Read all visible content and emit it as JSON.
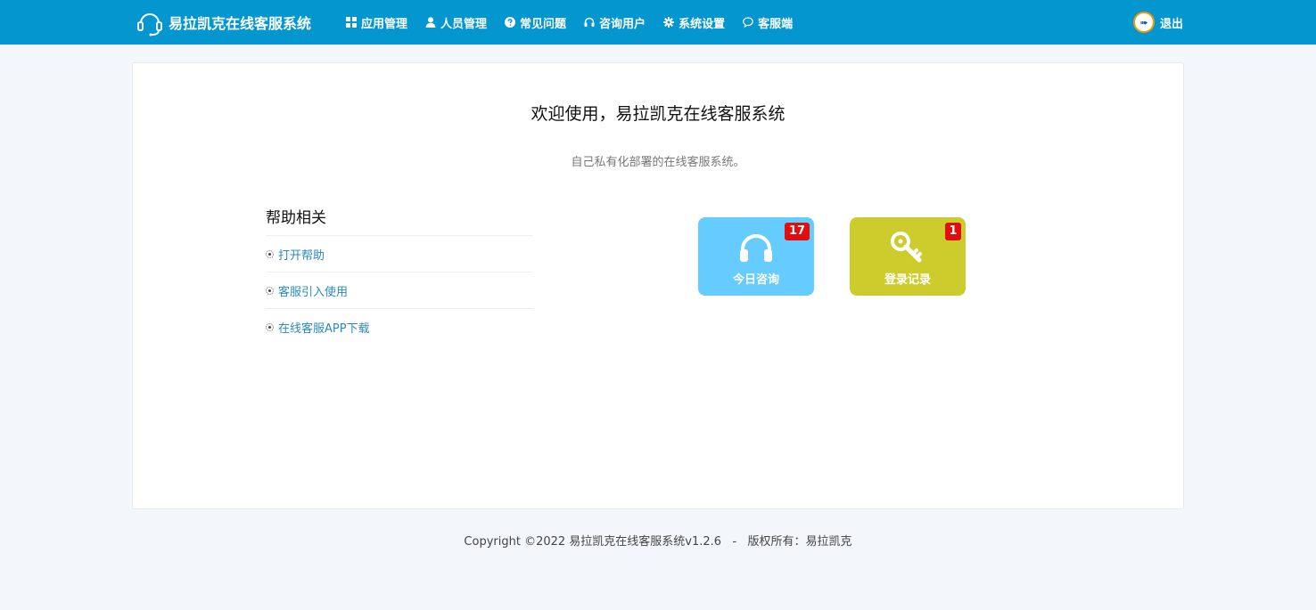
{
  "brand": {
    "title": "易拉凯克在线客服系统",
    "icon": "headset-icon"
  },
  "nav": {
    "items": [
      {
        "label": "应用管理",
        "icon": "grid-icon"
      },
      {
        "label": "人员管理",
        "icon": "user-icon"
      },
      {
        "label": "常见问题",
        "icon": "question-circle-icon"
      },
      {
        "label": "咨询用户",
        "icon": "headphones-icon"
      },
      {
        "label": "系统设置",
        "icon": "gear-icon"
      },
      {
        "label": "客服端",
        "icon": "chat-bubble-icon"
      }
    ],
    "logout_label": "退出"
  },
  "welcome": {
    "title": "欢迎使用，易拉凯克在线客服系统",
    "subtitle": "自己私有化部署的在线客服系统。"
  },
  "help": {
    "title": "帮助相关",
    "items": [
      {
        "label": "打开帮助"
      },
      {
        "label": "客服引入使用"
      },
      {
        "label": "在线客服APP下载"
      }
    ]
  },
  "tiles": {
    "today_consult": {
      "label": "今日咨询",
      "count": "17",
      "color": "#66ccff",
      "icon": "headphones-icon"
    },
    "login_records": {
      "label": "登录记录",
      "count": "1",
      "color": "#cdcc2d",
      "icon": "key-icon"
    }
  },
  "footer": {
    "text": "Copyright ©2022 易拉凯克在线客服系统v1.2.6   -   版权所有：易拉凯克"
  },
  "colors": {
    "navbar": "#0396cf",
    "badge": "#e20d0d",
    "link": "#2a8ac2",
    "background": "#f3f7fb"
  }
}
